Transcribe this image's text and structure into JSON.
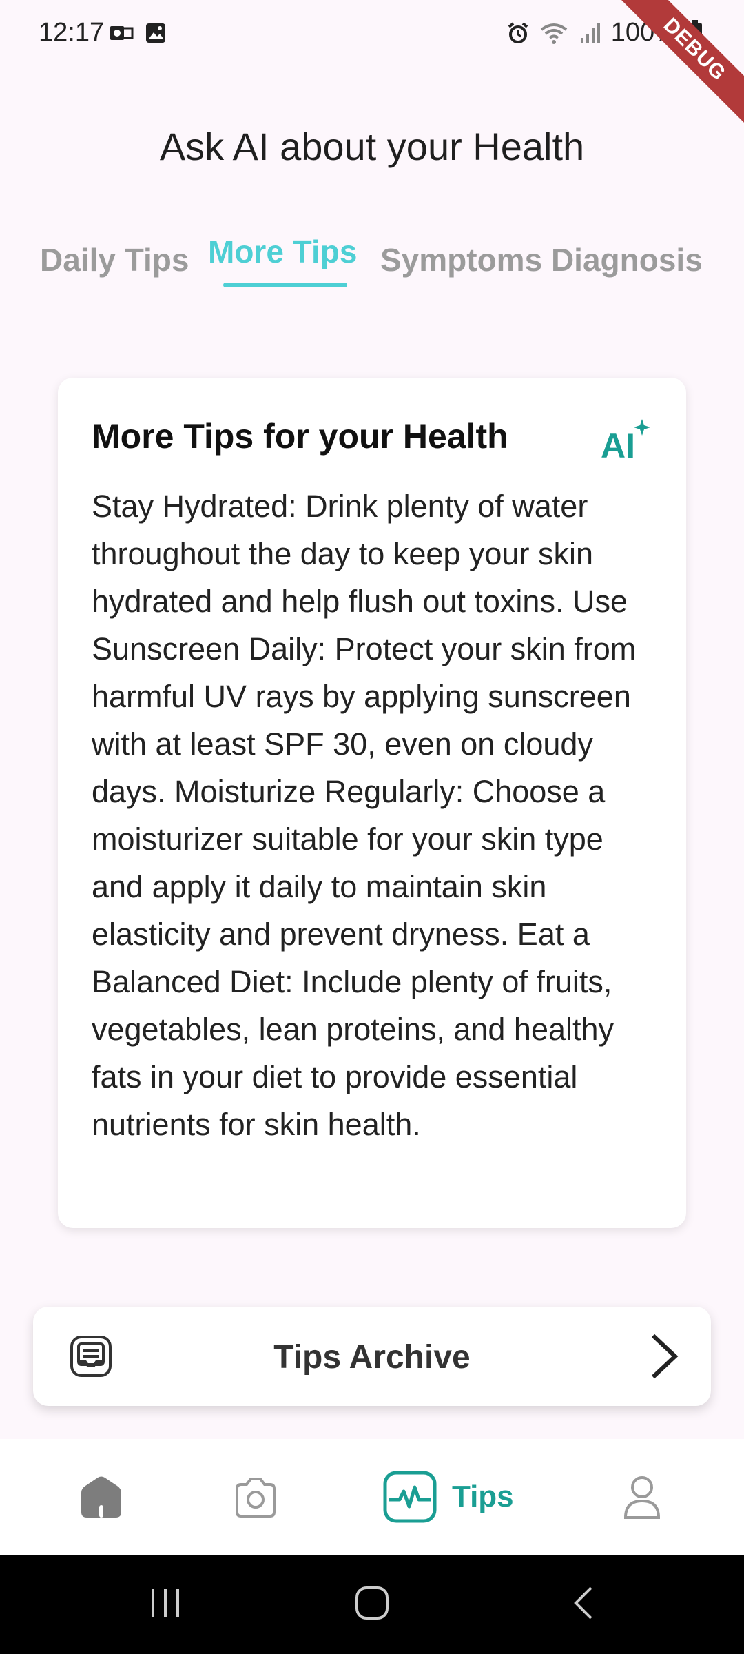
{
  "status_bar": {
    "time": "12:17",
    "battery": "100%",
    "debug_label": "DEBUG"
  },
  "header": {
    "title": "Ask AI about your Health"
  },
  "tabs": [
    {
      "label": "Daily Tips",
      "active": false
    },
    {
      "label": "More Tips",
      "active": true
    },
    {
      "label": "Symptoms Diagnosis",
      "active": false
    }
  ],
  "card": {
    "title": "More Tips for your Health",
    "ai_badge": "AI",
    "body": "Stay Hydrated: Drink plenty of water throughout the day to keep your skin hydrated and help flush out toxins. Use Sunscreen Daily: Protect your skin from harmful UV rays by applying sunscreen with at least SPF 30, even on cloudy days. Moisturize Regularly: Choose a moisturizer suitable for your skin type and apply it daily to maintain skin elasticity and prevent dryness. Eat a Balanced Diet: Include plenty of fruits, vegetables, lean proteins, and healthy fats in your diet to provide essential nutrients for skin health."
  },
  "archive": {
    "label": "Tips Archive",
    "icon": "archive-icon"
  },
  "bottom_nav": {
    "items": [
      {
        "icon": "home-icon",
        "label": ""
      },
      {
        "icon": "camera-icon",
        "label": ""
      },
      {
        "icon": "heart-pulse-icon",
        "label": "Tips",
        "active": true
      },
      {
        "icon": "profile-icon",
        "label": ""
      }
    ]
  },
  "colors": {
    "accent": "#4ecfd4",
    "nav_active": "#1a9e93",
    "background": "#fdf7fc"
  }
}
